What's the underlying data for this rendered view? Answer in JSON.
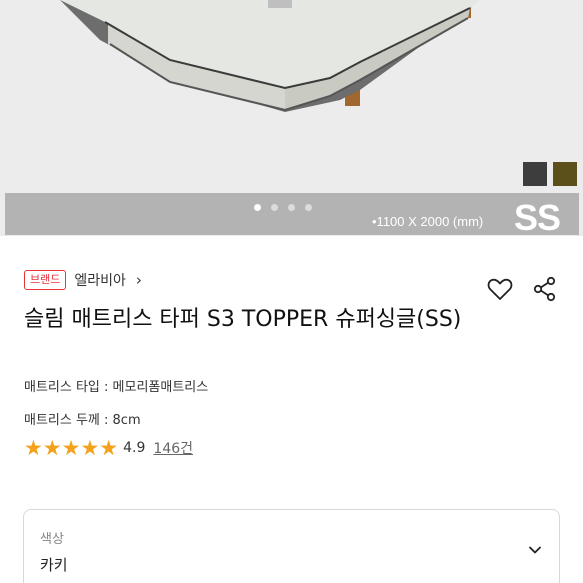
{
  "product_image": {
    "dimensions_text": "•1100 X 2000 (mm)",
    "size_code": "SS",
    "carousel_dots": 4,
    "active_dot": 0,
    "swatch_colors": [
      "#3d3d3d",
      "#5b4f1a"
    ]
  },
  "brand": {
    "badge": "브랜드",
    "name": "엘라비아",
    "chevron": "›"
  },
  "product": {
    "title": "슬림 매트리스 타퍼 S3 TOPPER 슈퍼싱글(SS)",
    "spec_type": "매트리스 타입 : 메모리폼매트리스",
    "spec_thickness": "매트리스 두께 : 8cm",
    "rating": "4.9",
    "review_count": "146건",
    "stars": "★★★★★"
  },
  "actions": {
    "wishlist_icon": "heart-icon",
    "share_icon": "share-icon"
  },
  "option": {
    "label": "색상",
    "value": "카키"
  },
  "colors": {
    "brand_red": "#e8323c",
    "star": "#f4a21b"
  }
}
